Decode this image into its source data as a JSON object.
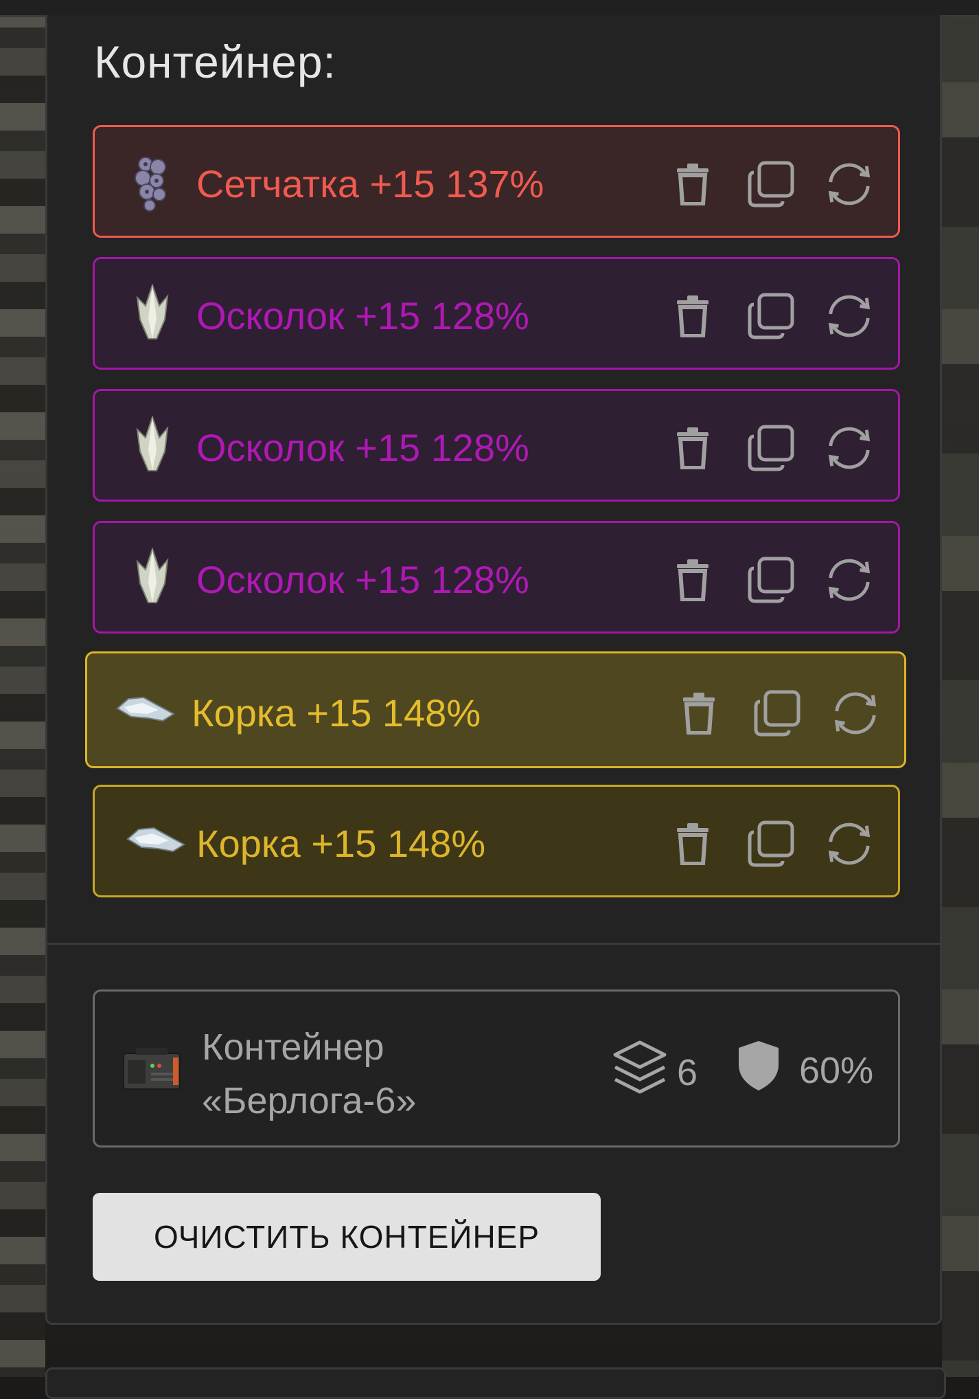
{
  "title": "Контейнер:",
  "items": [
    {
      "name": "Сетчатка +15 137%",
      "icon": "retina-artifact-icon",
      "rarity_color": "#f05a50"
    },
    {
      "name": "Осколок +15 128%",
      "icon": "shard-artifact-icon",
      "rarity_color": "#b018b4"
    },
    {
      "name": "Осколок +15 128%",
      "icon": "shard-artifact-icon",
      "rarity_color": "#b018b4"
    },
    {
      "name": "Осколок +15 128%",
      "icon": "shard-artifact-icon",
      "rarity_color": "#b018b4"
    },
    {
      "name": "Корка +15 148%",
      "icon": "crust-artifact-icon",
      "rarity_color": "#e5bd2c"
    },
    {
      "name": "Корка +15 148%",
      "icon": "crust-artifact-icon",
      "rarity_color": "#ddb52b"
    }
  ],
  "item_actions": [
    "trash-icon",
    "copy-icon",
    "refresh-icon"
  ],
  "container": {
    "name_line1": "Контейнер",
    "name_line2": "«Берлога-6»",
    "slots": "6",
    "protection": "60%",
    "icon": "container-case-icon"
  },
  "clear_button": "ОЧИСТИТЬ КОНТЕЙНЕР"
}
